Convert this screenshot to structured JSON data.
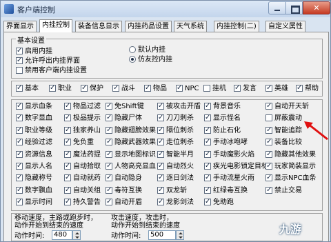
{
  "window": {
    "title": "客户端控制"
  },
  "tabs": [
    "界面显示",
    "内挂控制",
    "装备信息显示",
    "内挂药品设置",
    "天气系统",
    "内挂控制(二)",
    "自定义属性"
  ],
  "basic": {
    "title": "基本设置",
    "options": [
      {
        "label": "启用内挂",
        "checked": true
      },
      {
        "label": "允许呼出内挂界面",
        "checked": true
      },
      {
        "label": "禁用客户端内挂设置",
        "checked": false
      }
    ],
    "radios": [
      {
        "label": "默认内挂",
        "selected": false
      },
      {
        "label": "仿友控内挂",
        "selected": true
      }
    ]
  },
  "categories": [
    {
      "label": "基本",
      "checked": true
    },
    {
      "label": "职业",
      "checked": true
    },
    {
      "label": "保护",
      "checked": true
    },
    {
      "label": "战斗",
      "checked": true
    },
    {
      "label": "物品",
      "checked": true
    },
    {
      "label": "NPC",
      "checked": true
    },
    {
      "label": "挂机",
      "checked": false
    },
    {
      "label": "发言",
      "checked": true
    },
    {
      "label": "英雄",
      "checked": true
    },
    {
      "label": "帮助",
      "checked": true
    }
  ],
  "features": {
    "col1": [
      {
        "label": "显示血条",
        "checked": true
      },
      {
        "label": "数字显血",
        "checked": true
      },
      {
        "label": "职业等级",
        "checked": true
      },
      {
        "label": "经验过滤",
        "checked": true
      },
      {
        "label": "资源信息",
        "checked": true
      },
      {
        "label": "显示人名",
        "checked": true
      },
      {
        "label": "隐藏称号",
        "checked": true
      },
      {
        "label": "数字飘血",
        "checked": true
      },
      {
        "label": "显示时间",
        "checked": true
      }
    ],
    "col2": [
      {
        "label": "物品过滤",
        "checked": true
      },
      {
        "label": "极品提示",
        "checked": true
      },
      {
        "label": "独家养山",
        "checked": true
      },
      {
        "label": "免负重",
        "checked": true
      },
      {
        "label": "魔法药提",
        "checked": true
      },
      {
        "label": "自动拾取",
        "checked": true
      },
      {
        "label": "自动就药",
        "checked": true
      },
      {
        "label": "自动关组",
        "checked": true
      },
      {
        "label": "持久警告",
        "checked": true
      }
    ],
    "col3": [
      {
        "label": "免Shift键",
        "checked": true
      },
      {
        "label": "隐藏尸体",
        "checked": true
      },
      {
        "label": "隐藏翅膀效果",
        "checked": true
      },
      {
        "label": "隐藏武器效果",
        "checked": true
      },
      {
        "label": "显示地图标识",
        "checked": true
      },
      {
        "label": "人物高亮显血",
        "checked": true
      },
      {
        "label": "自动隐身",
        "checked": true
      },
      {
        "label": "毒符互换",
        "checked": true
      },
      {
        "label": "自动开盾",
        "checked": true
      }
    ],
    "col4": [
      {
        "label": "被攻击开盾",
        "checked": true
      },
      {
        "label": "刀刀刺杀",
        "checked": true
      },
      {
        "label": "隔位刺杀",
        "checked": true
      },
      {
        "label": "走位刺杀",
        "checked": true
      },
      {
        "label": "智能半月",
        "checked": true
      },
      {
        "label": "自动烈火",
        "checked": true
      },
      {
        "label": "逐日剑法",
        "checked": true
      },
      {
        "label": "双龙斩",
        "checked": true
      },
      {
        "label": "龙影剑法",
        "checked": true
      }
    ],
    "col5": [
      {
        "label": "背景音乐",
        "checked": true
      },
      {
        "label": "显示怪名",
        "checked": true
      },
      {
        "label": "防止石化",
        "checked": true
      },
      {
        "label": "手动冰咆哮",
        "checked": true
      },
      {
        "label": "手动魔影火焰",
        "checked": true
      },
      {
        "label": "疾光电影锁定目标",
        "checked": true
      },
      {
        "label": "手动流星火雨",
        "checked": true
      },
      {
        "label": "红绿毒互换",
        "checked": true
      },
      {
        "label": "免助跑",
        "checked": true
      }
    ],
    "col6": [
      {
        "label": "自动开天斩",
        "checked": true
      },
      {
        "label": "屏蔽震动",
        "checked": false
      },
      {
        "label": "智能追踪",
        "checked": true
      },
      {
        "label": "装备比较",
        "checked": true
      },
      {
        "label": "隐藏其他效果",
        "checked": true
      },
      {
        "label": "玩家简装显示",
        "checked": true
      },
      {
        "label": "显示NPC血条",
        "checked": true
      },
      {
        "label": "禁止交易",
        "checked": true
      }
    ]
  },
  "speed": {
    "move_line1": "移动速度，主路或跑步时，",
    "move_line2": "动作开始到结束的速度",
    "move_label": "动作时间:",
    "move_value": "480",
    "attack_line1": "攻击速度，攻击时，",
    "attack_line2": "动作开始到结束的速度",
    "attack_label": "动作时间:",
    "attack_value": "500"
  },
  "watermark": "九游",
  "colors": {
    "arrow": "#e01010",
    "close_button": "#c53a22",
    "title_gradient_top": "#dce8f6"
  }
}
